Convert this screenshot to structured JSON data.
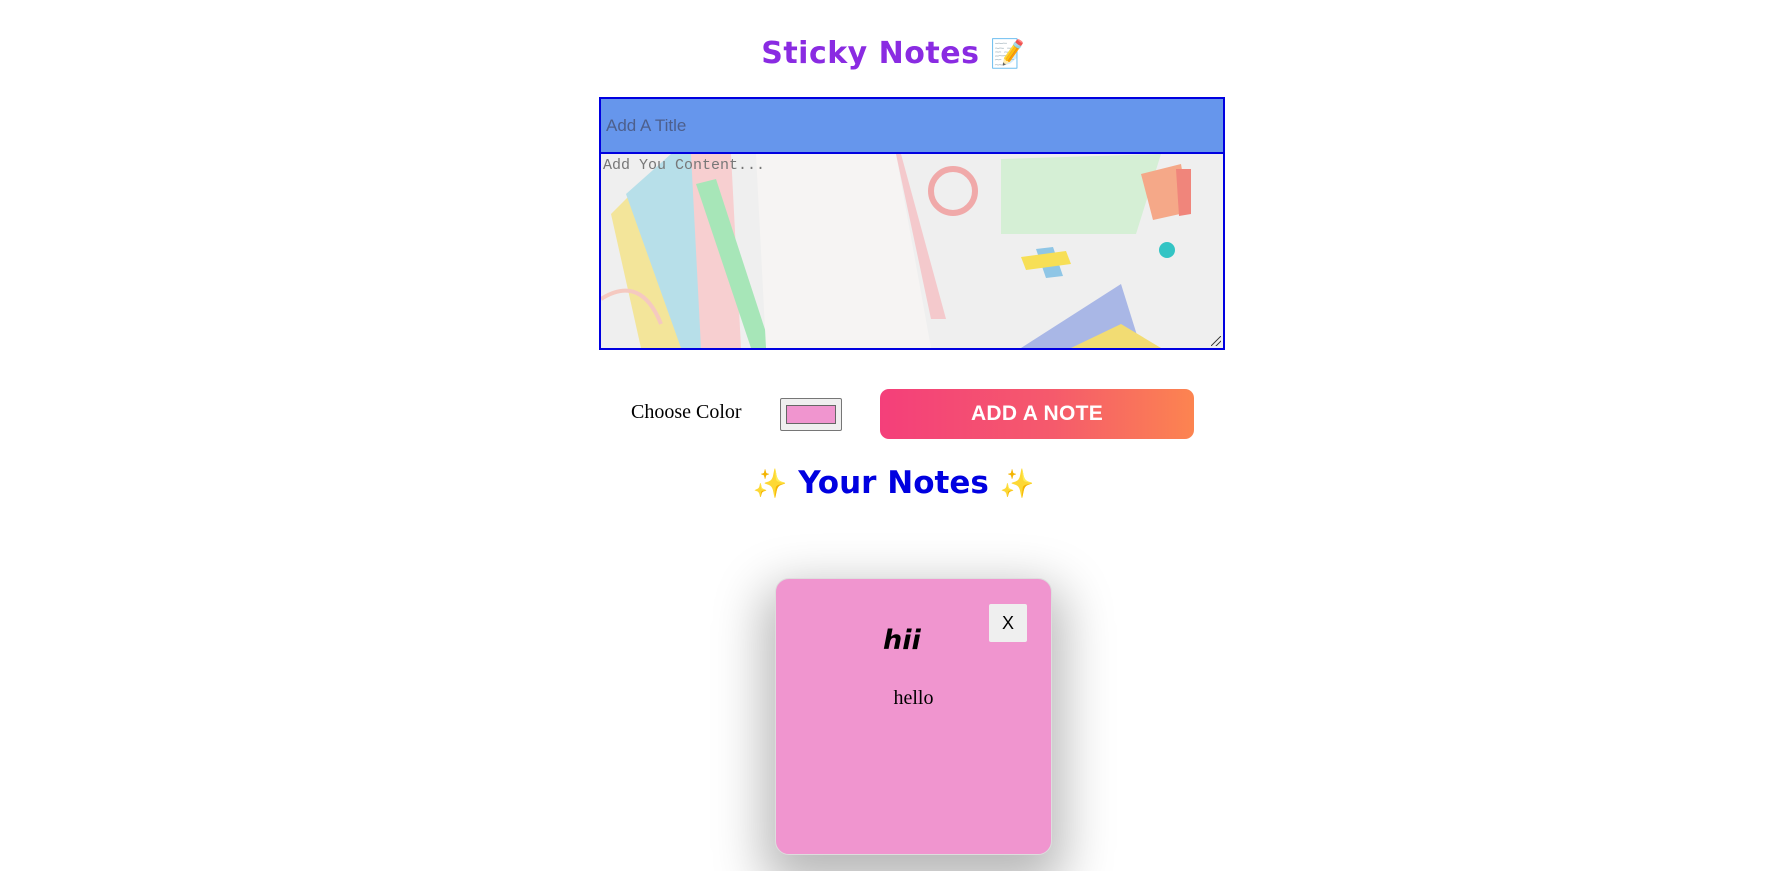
{
  "header": {
    "title": "Sticky Notes",
    "emoji": "📝"
  },
  "editor": {
    "title_placeholder": "Add A Title",
    "content_placeholder": "Add You Content..."
  },
  "controls": {
    "color_label": "Choose Color",
    "selected_color": "#f095cf",
    "add_button_label": "ADD A NOTE"
  },
  "notes_section": {
    "heading": "Your Notes",
    "sparkle": "✨"
  },
  "notes": [
    {
      "title": "hii",
      "content": "hello",
      "color": "#f095cf",
      "close_label": "X"
    }
  ],
  "colors": {
    "title_color": "#8a2be2",
    "heading_color": "#0000e0",
    "editor_title_bg": "#6696ec",
    "editor_border": "#0000e0",
    "button_gradient_start": "#f43f7a",
    "button_gradient_end": "#fc8450"
  }
}
